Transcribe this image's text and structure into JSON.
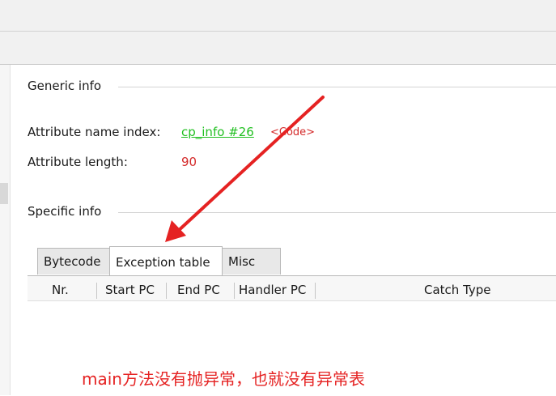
{
  "generic_info": {
    "title": "Generic info",
    "attribute_name_index_label": "Attribute name index:",
    "attribute_name_index_link": "cp_info #26",
    "attribute_name_index_comment": "<Code>",
    "attribute_length_label": "Attribute length:",
    "attribute_length_value": "90"
  },
  "specific_info": {
    "title": "Specific info",
    "tabs": [
      {
        "label": "Bytecode",
        "active": false
      },
      {
        "label": "Exception table",
        "active": true
      },
      {
        "label": "Misc",
        "active": false
      }
    ]
  },
  "exception_table": {
    "columns": [
      "Nr.",
      "Start PC",
      "End PC",
      "Handler PC",
      "Catch Type"
    ],
    "rows": []
  },
  "annotation": {
    "note": "main方法没有抛异常，也就没有异常表",
    "color": "#e52222"
  },
  "colors": {
    "link": "#22c022",
    "value_red": "#d42a2a"
  }
}
